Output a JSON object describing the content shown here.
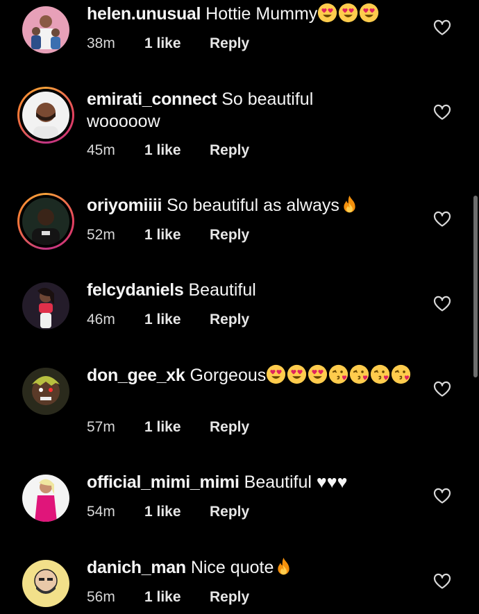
{
  "comments": [
    {
      "username": "helen.unusual",
      "text": "Hottie Mummy",
      "emoji": [
        "heart-eyes",
        "heart-eyes",
        "heart-eyes"
      ],
      "time": "38m",
      "likes": "1 like",
      "reply": "Reply"
    },
    {
      "username": "emirati_connect",
      "text": "So beautiful wooooow",
      "emoji": [],
      "time": "45m",
      "likes": "1 like",
      "reply": "Reply"
    },
    {
      "username": "oriyomiiii",
      "text": "So beautiful as always",
      "emoji": [
        "fire"
      ],
      "time": "52m",
      "likes": "1 like",
      "reply": "Reply"
    },
    {
      "username": "felcydaniels",
      "text": "Beautiful",
      "emoji": [],
      "time": "46m",
      "likes": "1 like",
      "reply": "Reply"
    },
    {
      "username": "don_gee_xk",
      "text": "Gorgeous",
      "emoji": [
        "heart-eyes",
        "heart-eyes",
        "heart-eyes",
        "kissing-heart",
        "kissing-heart",
        "kissing-heart",
        "kissing-heart"
      ],
      "time": "57m",
      "likes": "1 like",
      "reply": "Reply"
    },
    {
      "username": "official_mimi_mimi",
      "text": "Beautiful ♥♥♥",
      "emoji": [],
      "time": "54m",
      "likes": "1 like",
      "reply": "Reply"
    },
    {
      "username": "danich_man",
      "text": "Nice quote",
      "emoji": [
        "fire"
      ],
      "time": "56m",
      "likes": "1 like",
      "reply": "Reply"
    }
  ],
  "icons": {
    "like": "heart-outline-icon"
  },
  "colors": {
    "background": "#000000",
    "text": "#f5f5f5",
    "story_ring": "#e4405f"
  }
}
